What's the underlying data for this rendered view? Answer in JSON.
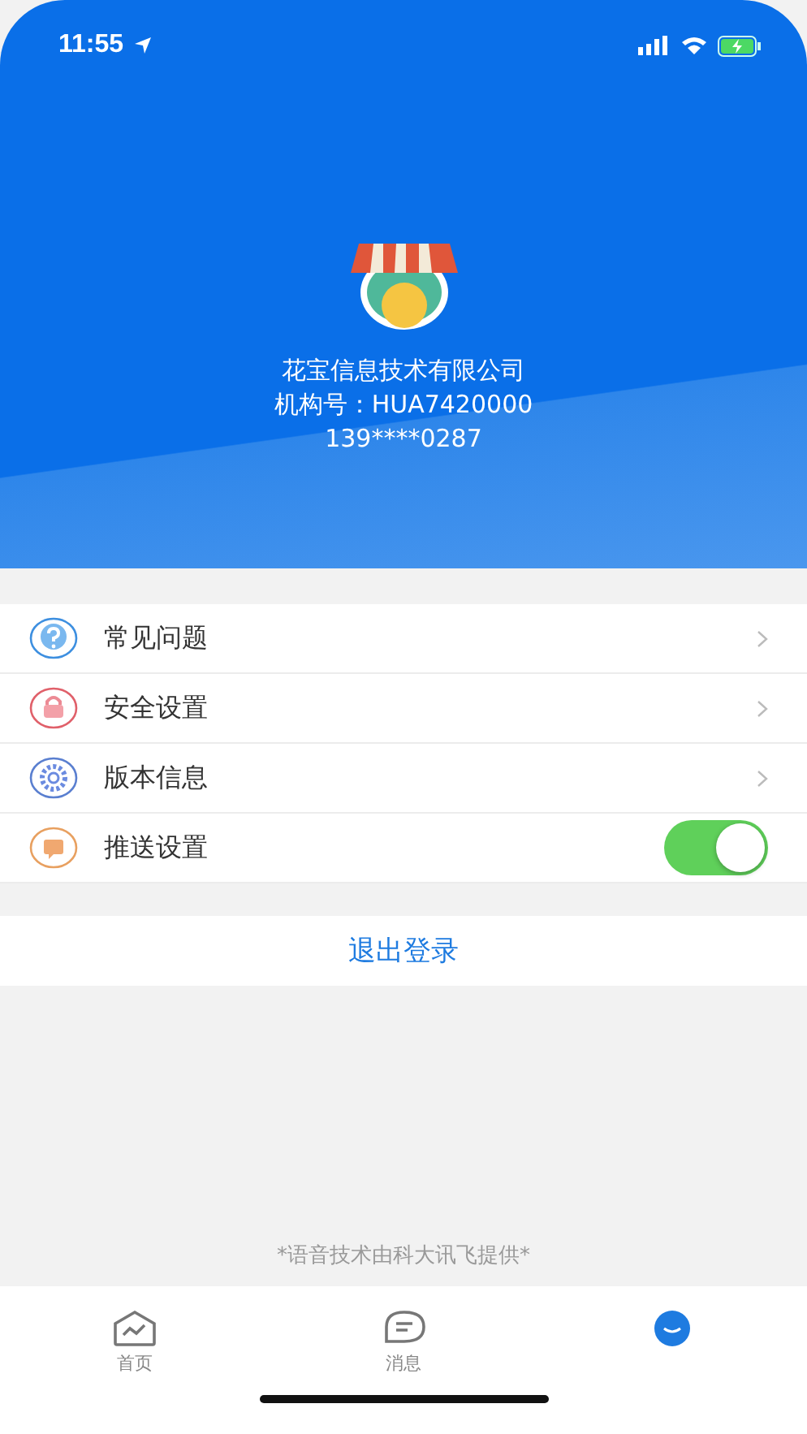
{
  "status_bar": {
    "time": "11:55"
  },
  "profile": {
    "company": "花宝信息技术有限公司",
    "org_id": "机构号：HUA7420000",
    "phone": "139****0287"
  },
  "menu": [
    {
      "label": "常见问题",
      "kind": "link"
    },
    {
      "label": "安全设置",
      "kind": "link"
    },
    {
      "label": "版本信息",
      "kind": "link"
    },
    {
      "label": "推送设置",
      "kind": "toggle",
      "on": true
    }
  ],
  "logout_button": "退出登录",
  "footer_note": "*语音技术由科大讯飞提供*",
  "tabs": [
    {
      "label": "首页",
      "selected": false
    },
    {
      "label": "消息",
      "selected": false
    },
    {
      "selected": true
    }
  ]
}
